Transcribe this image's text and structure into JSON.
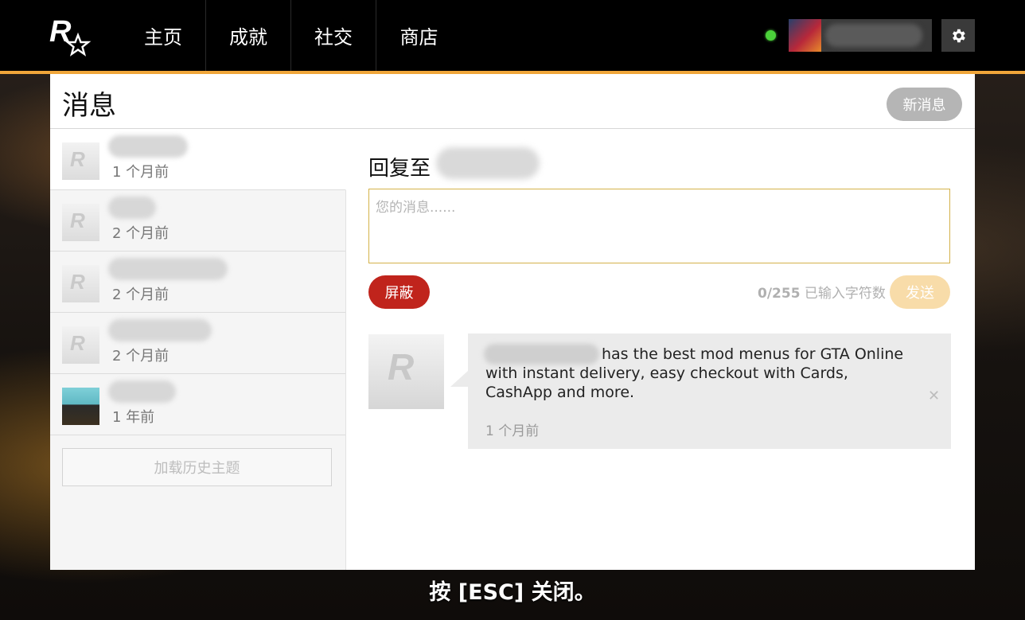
{
  "topbar": {
    "nav": [
      "主页",
      "成就",
      "社交",
      "商店"
    ]
  },
  "panel": {
    "title": "消息",
    "new_message_label": "新消息"
  },
  "conversations": [
    {
      "time": "1 个月前"
    },
    {
      "time": "2 个月前"
    },
    {
      "time": "2 个月前"
    },
    {
      "time": "2 个月前"
    },
    {
      "time": "1 年前"
    }
  ],
  "load_history_label": "加载历史主题",
  "reply": {
    "label": "回复至",
    "placeholder": "您的消息......",
    "block_label": "屏蔽",
    "char_count": "0/255",
    "char_count_suffix": " 已输入字符数",
    "send_label": "发送"
  },
  "message": {
    "text": "has the best mod menus for GTA Online with instant delivery, easy checkout with Cards, CashApp and more.",
    "time": "1 个月前"
  },
  "esc_hint": "按 [ESC] 关闭。",
  "colors": {
    "accent": "#f0a63a",
    "block": "#c0241c",
    "send": "#f8dca9",
    "online": "#4bd13a"
  }
}
